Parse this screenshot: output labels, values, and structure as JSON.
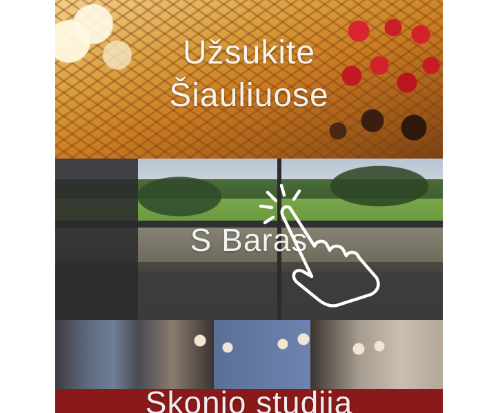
{
  "feed": {
    "cards": [
      {
        "title_line1": "Užsukite",
        "title_line2": "Šiauliuose",
        "image": "waffles-with-strawberries-and-cream"
      },
      {
        "title": "S Baras",
        "image": "outdoor-terrace-bar"
      },
      {
        "title": "Skonio studija",
        "image": "restaurant-interior"
      }
    ]
  },
  "overlay": {
    "gesture_icon": "tap-hand-icon"
  },
  "colors": {
    "title_text": "#ffffff",
    "page_background": "#ffffff"
  }
}
